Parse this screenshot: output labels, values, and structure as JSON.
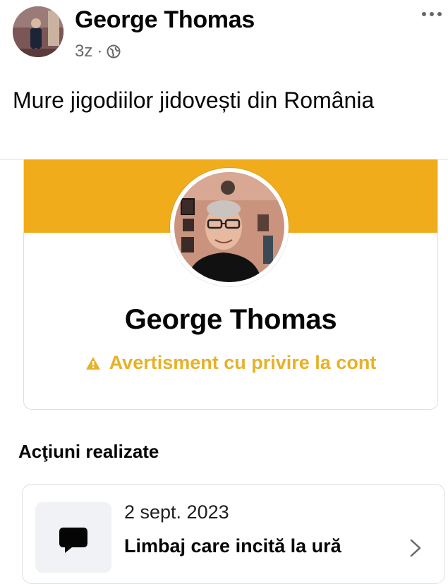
{
  "post": {
    "author": "George Thomas",
    "time": "3z",
    "separator": "·",
    "audience_icon": "globe-icon",
    "text": "Mure jigodiilor jidovești din România",
    "more_icon": "more-options-icon"
  },
  "card": {
    "banner_color": "#f0ac1b",
    "name": "George Thomas",
    "warning_icon": "warning-triangle-icon",
    "warning_text": "Avertisment cu privire la cont",
    "warning_color": "#e7b128"
  },
  "actions": {
    "title": "Acţiuni realizate",
    "items": [
      {
        "date": "2 sept. 2023",
        "label": "Limbaj care incită la ură",
        "icon": "chat-bubble-icon",
        "chevron": "chevron-right-icon"
      }
    ]
  }
}
